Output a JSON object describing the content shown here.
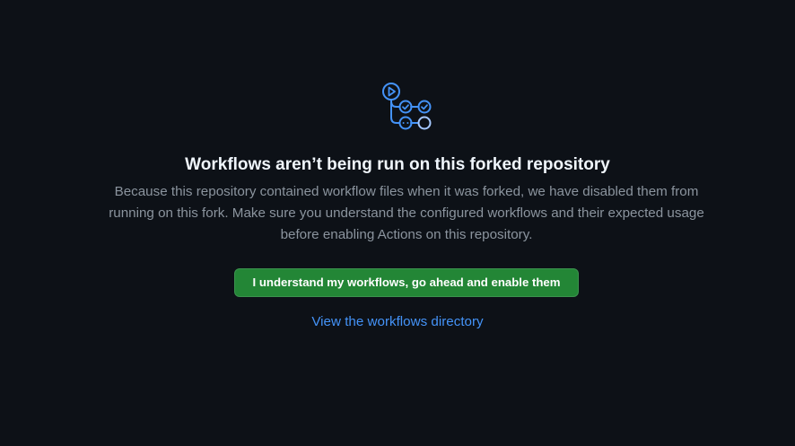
{
  "colors": {
    "background": "#0d1117",
    "title": "#f0f6fc",
    "muted": "#8b949e",
    "button": "#238636",
    "link": "#4493f8",
    "icon": "#4493f8"
  },
  "empty_state": {
    "icon": "workflow-graph-icon",
    "title": "Workflows aren’t being run on this forked repository",
    "description": "Because this repository contained workflow files when it was forked, we have disabled them from running on this fork. Make sure you understand the configured workflows and their expected usage before enabling Actions on this repository.",
    "enable_button_label": "I understand my workflows, go ahead and enable them",
    "workflows_link_label": "View the workflows directory"
  }
}
